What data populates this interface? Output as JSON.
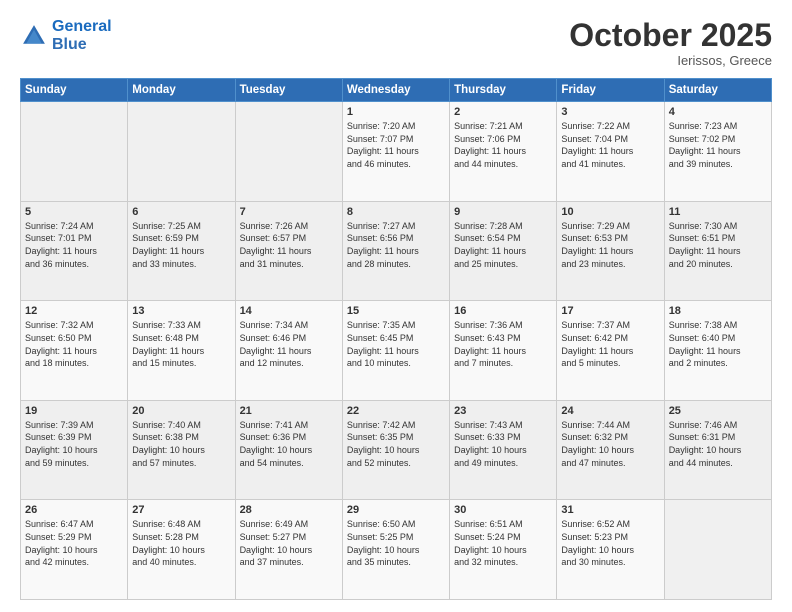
{
  "header": {
    "logo_line1": "General",
    "logo_line2": "Blue",
    "month": "October 2025",
    "location": "Ierissos, Greece"
  },
  "weekdays": [
    "Sunday",
    "Monday",
    "Tuesday",
    "Wednesday",
    "Thursday",
    "Friday",
    "Saturday"
  ],
  "weeks": [
    [
      {
        "day": "",
        "info": ""
      },
      {
        "day": "",
        "info": ""
      },
      {
        "day": "",
        "info": ""
      },
      {
        "day": "1",
        "info": "Sunrise: 7:20 AM\nSunset: 7:07 PM\nDaylight: 11 hours\nand 46 minutes."
      },
      {
        "day": "2",
        "info": "Sunrise: 7:21 AM\nSunset: 7:06 PM\nDaylight: 11 hours\nand 44 minutes."
      },
      {
        "day": "3",
        "info": "Sunrise: 7:22 AM\nSunset: 7:04 PM\nDaylight: 11 hours\nand 41 minutes."
      },
      {
        "day": "4",
        "info": "Sunrise: 7:23 AM\nSunset: 7:02 PM\nDaylight: 11 hours\nand 39 minutes."
      }
    ],
    [
      {
        "day": "5",
        "info": "Sunrise: 7:24 AM\nSunset: 7:01 PM\nDaylight: 11 hours\nand 36 minutes."
      },
      {
        "day": "6",
        "info": "Sunrise: 7:25 AM\nSunset: 6:59 PM\nDaylight: 11 hours\nand 33 minutes."
      },
      {
        "day": "7",
        "info": "Sunrise: 7:26 AM\nSunset: 6:57 PM\nDaylight: 11 hours\nand 31 minutes."
      },
      {
        "day": "8",
        "info": "Sunrise: 7:27 AM\nSunset: 6:56 PM\nDaylight: 11 hours\nand 28 minutes."
      },
      {
        "day": "9",
        "info": "Sunrise: 7:28 AM\nSunset: 6:54 PM\nDaylight: 11 hours\nand 25 minutes."
      },
      {
        "day": "10",
        "info": "Sunrise: 7:29 AM\nSunset: 6:53 PM\nDaylight: 11 hours\nand 23 minutes."
      },
      {
        "day": "11",
        "info": "Sunrise: 7:30 AM\nSunset: 6:51 PM\nDaylight: 11 hours\nand 20 minutes."
      }
    ],
    [
      {
        "day": "12",
        "info": "Sunrise: 7:32 AM\nSunset: 6:50 PM\nDaylight: 11 hours\nand 18 minutes."
      },
      {
        "day": "13",
        "info": "Sunrise: 7:33 AM\nSunset: 6:48 PM\nDaylight: 11 hours\nand 15 minutes."
      },
      {
        "day": "14",
        "info": "Sunrise: 7:34 AM\nSunset: 6:46 PM\nDaylight: 11 hours\nand 12 minutes."
      },
      {
        "day": "15",
        "info": "Sunrise: 7:35 AM\nSunset: 6:45 PM\nDaylight: 11 hours\nand 10 minutes."
      },
      {
        "day": "16",
        "info": "Sunrise: 7:36 AM\nSunset: 6:43 PM\nDaylight: 11 hours\nand 7 minutes."
      },
      {
        "day": "17",
        "info": "Sunrise: 7:37 AM\nSunset: 6:42 PM\nDaylight: 11 hours\nand 5 minutes."
      },
      {
        "day": "18",
        "info": "Sunrise: 7:38 AM\nSunset: 6:40 PM\nDaylight: 11 hours\nand 2 minutes."
      }
    ],
    [
      {
        "day": "19",
        "info": "Sunrise: 7:39 AM\nSunset: 6:39 PM\nDaylight: 10 hours\nand 59 minutes."
      },
      {
        "day": "20",
        "info": "Sunrise: 7:40 AM\nSunset: 6:38 PM\nDaylight: 10 hours\nand 57 minutes."
      },
      {
        "day": "21",
        "info": "Sunrise: 7:41 AM\nSunset: 6:36 PM\nDaylight: 10 hours\nand 54 minutes."
      },
      {
        "day": "22",
        "info": "Sunrise: 7:42 AM\nSunset: 6:35 PM\nDaylight: 10 hours\nand 52 minutes."
      },
      {
        "day": "23",
        "info": "Sunrise: 7:43 AM\nSunset: 6:33 PM\nDaylight: 10 hours\nand 49 minutes."
      },
      {
        "day": "24",
        "info": "Sunrise: 7:44 AM\nSunset: 6:32 PM\nDaylight: 10 hours\nand 47 minutes."
      },
      {
        "day": "25",
        "info": "Sunrise: 7:46 AM\nSunset: 6:31 PM\nDaylight: 10 hours\nand 44 minutes."
      }
    ],
    [
      {
        "day": "26",
        "info": "Sunrise: 6:47 AM\nSunset: 5:29 PM\nDaylight: 10 hours\nand 42 minutes."
      },
      {
        "day": "27",
        "info": "Sunrise: 6:48 AM\nSunset: 5:28 PM\nDaylight: 10 hours\nand 40 minutes."
      },
      {
        "day": "28",
        "info": "Sunrise: 6:49 AM\nSunset: 5:27 PM\nDaylight: 10 hours\nand 37 minutes."
      },
      {
        "day": "29",
        "info": "Sunrise: 6:50 AM\nSunset: 5:25 PM\nDaylight: 10 hours\nand 35 minutes."
      },
      {
        "day": "30",
        "info": "Sunrise: 6:51 AM\nSunset: 5:24 PM\nDaylight: 10 hours\nand 32 minutes."
      },
      {
        "day": "31",
        "info": "Sunrise: 6:52 AM\nSunset: 5:23 PM\nDaylight: 10 hours\nand 30 minutes."
      },
      {
        "day": "",
        "info": ""
      }
    ]
  ]
}
